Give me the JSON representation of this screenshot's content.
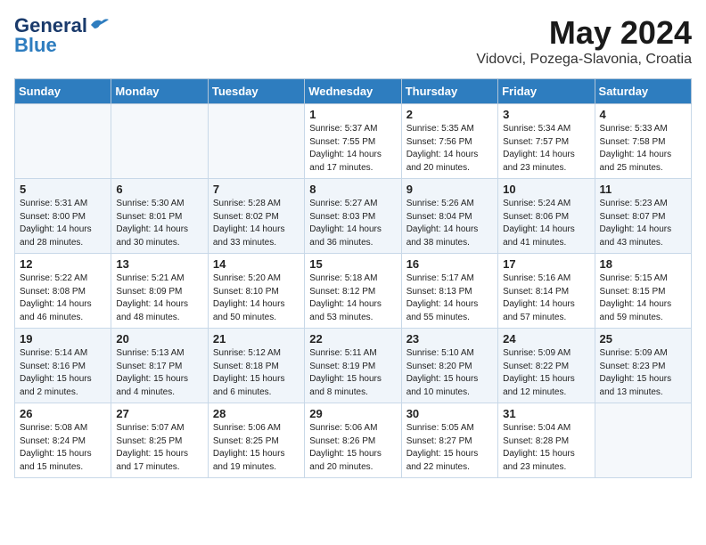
{
  "header": {
    "logo_general": "General",
    "logo_blue": "Blue",
    "month": "May 2024",
    "location": "Vidovci, Pozega-Slavonia, Croatia"
  },
  "days_of_week": [
    "Sunday",
    "Monday",
    "Tuesday",
    "Wednesday",
    "Thursday",
    "Friday",
    "Saturday"
  ],
  "weeks": [
    [
      {
        "day": "",
        "info": ""
      },
      {
        "day": "",
        "info": ""
      },
      {
        "day": "",
        "info": ""
      },
      {
        "day": "1",
        "info": "Sunrise: 5:37 AM\nSunset: 7:55 PM\nDaylight: 14 hours and 17 minutes."
      },
      {
        "day": "2",
        "info": "Sunrise: 5:35 AM\nSunset: 7:56 PM\nDaylight: 14 hours and 20 minutes."
      },
      {
        "day": "3",
        "info": "Sunrise: 5:34 AM\nSunset: 7:57 PM\nDaylight: 14 hours and 23 minutes."
      },
      {
        "day": "4",
        "info": "Sunrise: 5:33 AM\nSunset: 7:58 PM\nDaylight: 14 hours and 25 minutes."
      }
    ],
    [
      {
        "day": "5",
        "info": "Sunrise: 5:31 AM\nSunset: 8:00 PM\nDaylight: 14 hours and 28 minutes."
      },
      {
        "day": "6",
        "info": "Sunrise: 5:30 AM\nSunset: 8:01 PM\nDaylight: 14 hours and 30 minutes."
      },
      {
        "day": "7",
        "info": "Sunrise: 5:28 AM\nSunset: 8:02 PM\nDaylight: 14 hours and 33 minutes."
      },
      {
        "day": "8",
        "info": "Sunrise: 5:27 AM\nSunset: 8:03 PM\nDaylight: 14 hours and 36 minutes."
      },
      {
        "day": "9",
        "info": "Sunrise: 5:26 AM\nSunset: 8:04 PM\nDaylight: 14 hours and 38 minutes."
      },
      {
        "day": "10",
        "info": "Sunrise: 5:24 AM\nSunset: 8:06 PM\nDaylight: 14 hours and 41 minutes."
      },
      {
        "day": "11",
        "info": "Sunrise: 5:23 AM\nSunset: 8:07 PM\nDaylight: 14 hours and 43 minutes."
      }
    ],
    [
      {
        "day": "12",
        "info": "Sunrise: 5:22 AM\nSunset: 8:08 PM\nDaylight: 14 hours and 46 minutes."
      },
      {
        "day": "13",
        "info": "Sunrise: 5:21 AM\nSunset: 8:09 PM\nDaylight: 14 hours and 48 minutes."
      },
      {
        "day": "14",
        "info": "Sunrise: 5:20 AM\nSunset: 8:10 PM\nDaylight: 14 hours and 50 minutes."
      },
      {
        "day": "15",
        "info": "Sunrise: 5:18 AM\nSunset: 8:12 PM\nDaylight: 14 hours and 53 minutes."
      },
      {
        "day": "16",
        "info": "Sunrise: 5:17 AM\nSunset: 8:13 PM\nDaylight: 14 hours and 55 minutes."
      },
      {
        "day": "17",
        "info": "Sunrise: 5:16 AM\nSunset: 8:14 PM\nDaylight: 14 hours and 57 minutes."
      },
      {
        "day": "18",
        "info": "Sunrise: 5:15 AM\nSunset: 8:15 PM\nDaylight: 14 hours and 59 minutes."
      }
    ],
    [
      {
        "day": "19",
        "info": "Sunrise: 5:14 AM\nSunset: 8:16 PM\nDaylight: 15 hours and 2 minutes."
      },
      {
        "day": "20",
        "info": "Sunrise: 5:13 AM\nSunset: 8:17 PM\nDaylight: 15 hours and 4 minutes."
      },
      {
        "day": "21",
        "info": "Sunrise: 5:12 AM\nSunset: 8:18 PM\nDaylight: 15 hours and 6 minutes."
      },
      {
        "day": "22",
        "info": "Sunrise: 5:11 AM\nSunset: 8:19 PM\nDaylight: 15 hours and 8 minutes."
      },
      {
        "day": "23",
        "info": "Sunrise: 5:10 AM\nSunset: 8:20 PM\nDaylight: 15 hours and 10 minutes."
      },
      {
        "day": "24",
        "info": "Sunrise: 5:09 AM\nSunset: 8:22 PM\nDaylight: 15 hours and 12 minutes."
      },
      {
        "day": "25",
        "info": "Sunrise: 5:09 AM\nSunset: 8:23 PM\nDaylight: 15 hours and 13 minutes."
      }
    ],
    [
      {
        "day": "26",
        "info": "Sunrise: 5:08 AM\nSunset: 8:24 PM\nDaylight: 15 hours and 15 minutes."
      },
      {
        "day": "27",
        "info": "Sunrise: 5:07 AM\nSunset: 8:25 PM\nDaylight: 15 hours and 17 minutes."
      },
      {
        "day": "28",
        "info": "Sunrise: 5:06 AM\nSunset: 8:25 PM\nDaylight: 15 hours and 19 minutes."
      },
      {
        "day": "29",
        "info": "Sunrise: 5:06 AM\nSunset: 8:26 PM\nDaylight: 15 hours and 20 minutes."
      },
      {
        "day": "30",
        "info": "Sunrise: 5:05 AM\nSunset: 8:27 PM\nDaylight: 15 hours and 22 minutes."
      },
      {
        "day": "31",
        "info": "Sunrise: 5:04 AM\nSunset: 8:28 PM\nDaylight: 15 hours and 23 minutes."
      },
      {
        "day": "",
        "info": ""
      }
    ]
  ]
}
